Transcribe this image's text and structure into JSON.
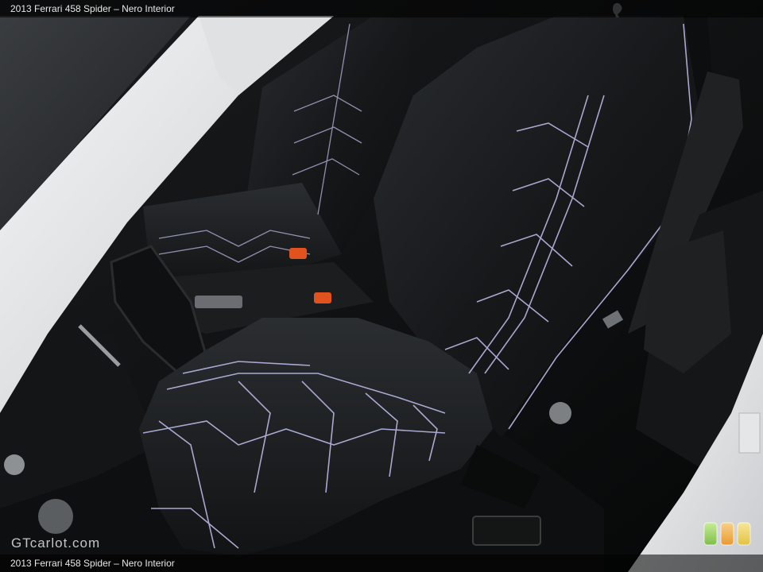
{
  "caption": {
    "top": "2013 Ferrari 458 Spider – Nero Interior",
    "bottom": "2013 Ferrari 458 Spider – Nero Interior"
  },
  "watermark": "GTcarlot.com",
  "colors": {
    "leather": "#16181a",
    "stitching": "#b9b7e6",
    "door_frame": "#eceeef",
    "accent_orange": "#e0531f",
    "badge_green": "#9bd16a",
    "badge_orange": "#f2b45a",
    "badge_yellow": "#f0d76a"
  },
  "icons": [
    "ferrari-horse-icon",
    "rating-badges-icon"
  ]
}
